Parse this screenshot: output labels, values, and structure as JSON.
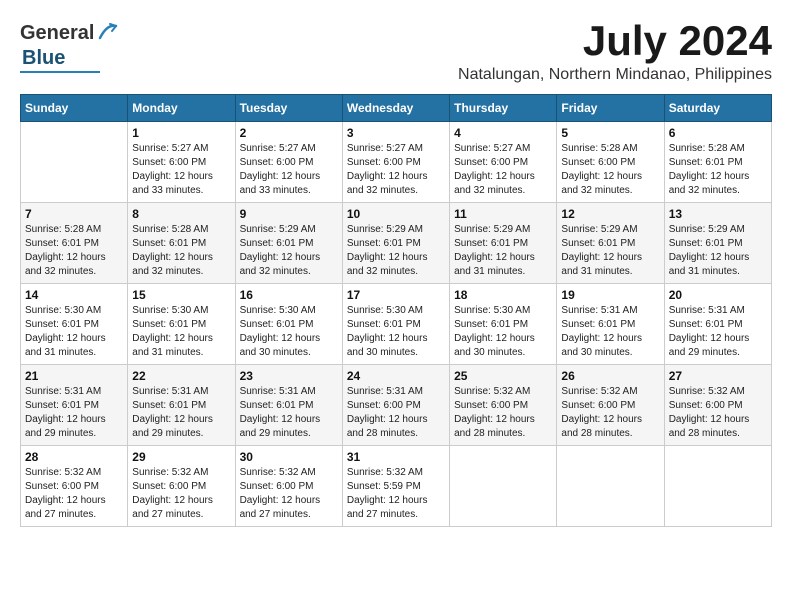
{
  "header": {
    "logo_general": "General",
    "logo_blue": "Blue",
    "month_year": "July 2024",
    "location": "Natalungan, Northern Mindanao, Philippines"
  },
  "calendar": {
    "days_of_week": [
      "Sunday",
      "Monday",
      "Tuesday",
      "Wednesday",
      "Thursday",
      "Friday",
      "Saturday"
    ],
    "weeks": [
      [
        {
          "day": "",
          "info": ""
        },
        {
          "day": "1",
          "info": "Sunrise: 5:27 AM\nSunset: 6:00 PM\nDaylight: 12 hours\nand 33 minutes."
        },
        {
          "day": "2",
          "info": "Sunrise: 5:27 AM\nSunset: 6:00 PM\nDaylight: 12 hours\nand 33 minutes."
        },
        {
          "day": "3",
          "info": "Sunrise: 5:27 AM\nSunset: 6:00 PM\nDaylight: 12 hours\nand 32 minutes."
        },
        {
          "day": "4",
          "info": "Sunrise: 5:27 AM\nSunset: 6:00 PM\nDaylight: 12 hours\nand 32 minutes."
        },
        {
          "day": "5",
          "info": "Sunrise: 5:28 AM\nSunset: 6:00 PM\nDaylight: 12 hours\nand 32 minutes."
        },
        {
          "day": "6",
          "info": "Sunrise: 5:28 AM\nSunset: 6:01 PM\nDaylight: 12 hours\nand 32 minutes."
        }
      ],
      [
        {
          "day": "7",
          "info": "Sunrise: 5:28 AM\nSunset: 6:01 PM\nDaylight: 12 hours\nand 32 minutes."
        },
        {
          "day": "8",
          "info": "Sunrise: 5:28 AM\nSunset: 6:01 PM\nDaylight: 12 hours\nand 32 minutes."
        },
        {
          "day": "9",
          "info": "Sunrise: 5:29 AM\nSunset: 6:01 PM\nDaylight: 12 hours\nand 32 minutes."
        },
        {
          "day": "10",
          "info": "Sunrise: 5:29 AM\nSunset: 6:01 PM\nDaylight: 12 hours\nand 32 minutes."
        },
        {
          "day": "11",
          "info": "Sunrise: 5:29 AM\nSunset: 6:01 PM\nDaylight: 12 hours\nand 31 minutes."
        },
        {
          "day": "12",
          "info": "Sunrise: 5:29 AM\nSunset: 6:01 PM\nDaylight: 12 hours\nand 31 minutes."
        },
        {
          "day": "13",
          "info": "Sunrise: 5:29 AM\nSunset: 6:01 PM\nDaylight: 12 hours\nand 31 minutes."
        }
      ],
      [
        {
          "day": "14",
          "info": "Sunrise: 5:30 AM\nSunset: 6:01 PM\nDaylight: 12 hours\nand 31 minutes."
        },
        {
          "day": "15",
          "info": "Sunrise: 5:30 AM\nSunset: 6:01 PM\nDaylight: 12 hours\nand 31 minutes."
        },
        {
          "day": "16",
          "info": "Sunrise: 5:30 AM\nSunset: 6:01 PM\nDaylight: 12 hours\nand 30 minutes."
        },
        {
          "day": "17",
          "info": "Sunrise: 5:30 AM\nSunset: 6:01 PM\nDaylight: 12 hours\nand 30 minutes."
        },
        {
          "day": "18",
          "info": "Sunrise: 5:30 AM\nSunset: 6:01 PM\nDaylight: 12 hours\nand 30 minutes."
        },
        {
          "day": "19",
          "info": "Sunrise: 5:31 AM\nSunset: 6:01 PM\nDaylight: 12 hours\nand 30 minutes."
        },
        {
          "day": "20",
          "info": "Sunrise: 5:31 AM\nSunset: 6:01 PM\nDaylight: 12 hours\nand 29 minutes."
        }
      ],
      [
        {
          "day": "21",
          "info": "Sunrise: 5:31 AM\nSunset: 6:01 PM\nDaylight: 12 hours\nand 29 minutes."
        },
        {
          "day": "22",
          "info": "Sunrise: 5:31 AM\nSunset: 6:01 PM\nDaylight: 12 hours\nand 29 minutes."
        },
        {
          "day": "23",
          "info": "Sunrise: 5:31 AM\nSunset: 6:01 PM\nDaylight: 12 hours\nand 29 minutes."
        },
        {
          "day": "24",
          "info": "Sunrise: 5:31 AM\nSunset: 6:00 PM\nDaylight: 12 hours\nand 28 minutes."
        },
        {
          "day": "25",
          "info": "Sunrise: 5:32 AM\nSunset: 6:00 PM\nDaylight: 12 hours\nand 28 minutes."
        },
        {
          "day": "26",
          "info": "Sunrise: 5:32 AM\nSunset: 6:00 PM\nDaylight: 12 hours\nand 28 minutes."
        },
        {
          "day": "27",
          "info": "Sunrise: 5:32 AM\nSunset: 6:00 PM\nDaylight: 12 hours\nand 28 minutes."
        }
      ],
      [
        {
          "day": "28",
          "info": "Sunrise: 5:32 AM\nSunset: 6:00 PM\nDaylight: 12 hours\nand 27 minutes."
        },
        {
          "day": "29",
          "info": "Sunrise: 5:32 AM\nSunset: 6:00 PM\nDaylight: 12 hours\nand 27 minutes."
        },
        {
          "day": "30",
          "info": "Sunrise: 5:32 AM\nSunset: 6:00 PM\nDaylight: 12 hours\nand 27 minutes."
        },
        {
          "day": "31",
          "info": "Sunrise: 5:32 AM\nSunset: 5:59 PM\nDaylight: 12 hours\nand 27 minutes."
        },
        {
          "day": "",
          "info": ""
        },
        {
          "day": "",
          "info": ""
        },
        {
          "day": "",
          "info": ""
        }
      ]
    ]
  }
}
